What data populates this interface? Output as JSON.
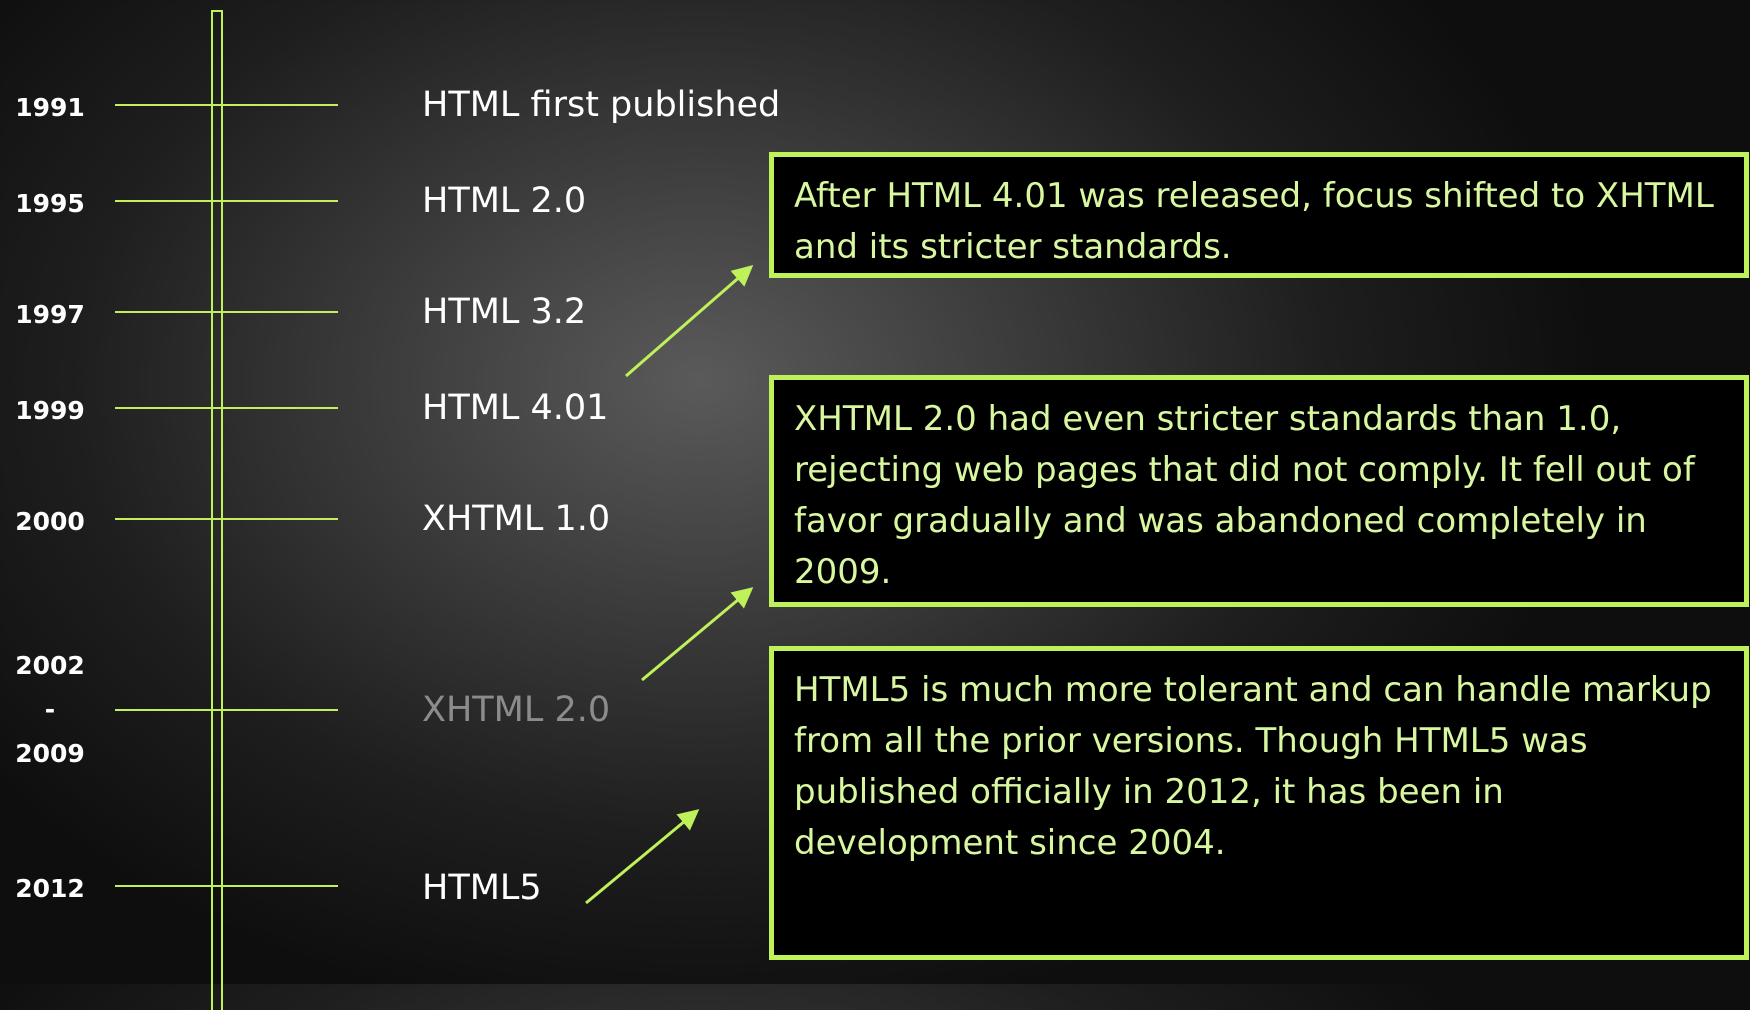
{
  "accent_color": "#bff15a",
  "milestones": [
    {
      "year": "1991",
      "event": "HTML first published"
    },
    {
      "year": "1995",
      "event": "HTML 2.0"
    },
    {
      "year": "1997",
      "event": "HTML 3.2"
    },
    {
      "year": "1999",
      "event": "HTML 4.01"
    },
    {
      "year": "2000",
      "event": "XHTML 1.0"
    },
    {
      "year_lines": [
        "2002",
        "-",
        "2009"
      ],
      "event": "XHTML 2.0"
    },
    {
      "year": "2012",
      "event": "HTML5"
    }
  ],
  "notes": [
    "After HTML 4.01 was released, focus shifted to XHTML and its stricter standards.",
    "XHTML 2.0 had even stricter standards than 1.0, rejecting web pages that did not comply.  It fell out of favor gradually and was abandoned completely in 2009.",
    "HTML5 is much more tolerant and can handle markup from all the prior versions. Though HTML5 was published officially in 2012, it has been in development since 2004."
  ]
}
